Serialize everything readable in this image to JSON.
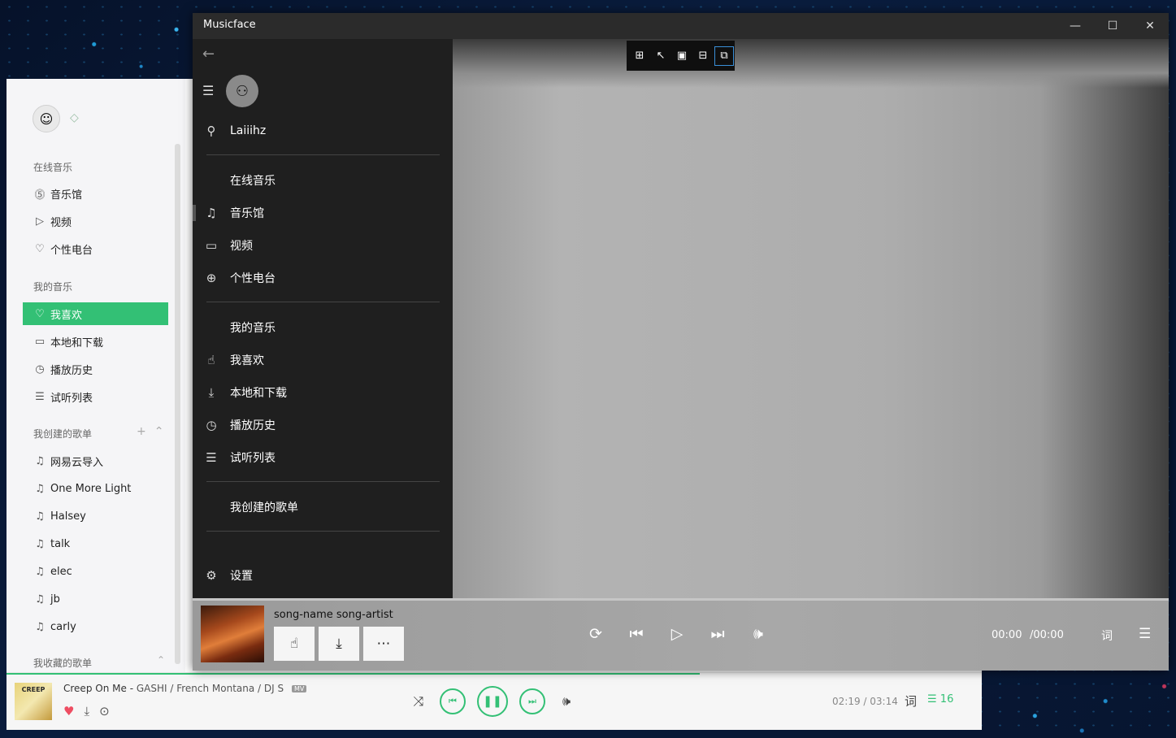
{
  "back_app": {
    "section_online": "在线音乐",
    "online_items": [
      {
        "icon": "music-hall-icon",
        "glyph": "⓹",
        "label": "音乐馆"
      },
      {
        "icon": "video-icon",
        "glyph": "▷",
        "label": "视频"
      },
      {
        "icon": "radio-heart-icon",
        "glyph": "♡",
        "label": "个性电台"
      }
    ],
    "section_my": "我的音乐",
    "my_items": [
      {
        "icon": "heart-icon",
        "glyph": "♡",
        "label": "我喜欢"
      },
      {
        "icon": "monitor-icon",
        "glyph": "▭",
        "label": "本地和下载"
      },
      {
        "icon": "clock-icon",
        "glyph": "◷",
        "label": "播放历史"
      },
      {
        "icon": "trial-list-icon",
        "glyph": "☰",
        "label": "试听列表"
      }
    ],
    "section_created": "我创建的歌单",
    "playlists": [
      "网易云导入",
      "One More Light",
      "Halsey",
      "talk",
      "elec",
      "jb",
      "carly"
    ],
    "section_collected": "我收藏的歌单",
    "now_playing": {
      "title": "Creep On Me",
      "artists": "GASHI / French Montana / DJ S",
      "badge": "MV",
      "time": "02:19 / 03:14",
      "lyrics_label": "词",
      "queue_count": "16",
      "cover_text": "CREEP"
    },
    "accent": "#33c075"
  },
  "musicface": {
    "window_title": "Musicface",
    "window_buttons": [
      "—",
      "☐",
      "✕"
    ],
    "username": "Laiiihz",
    "online_header": "在线音乐",
    "online_items": [
      {
        "icon": "music-note-icon",
        "glyph": "♫",
        "label": "音乐馆"
      },
      {
        "icon": "video-camera-icon",
        "glyph": "▭",
        "label": "视频"
      },
      {
        "icon": "globe-icon",
        "glyph": "⊕",
        "label": "个性电台"
      }
    ],
    "my_header": "我的音乐",
    "my_items": [
      {
        "icon": "thumbs-up-icon",
        "glyph": "☝",
        "label": "我喜欢"
      },
      {
        "icon": "download-icon",
        "glyph": "⤓",
        "label": "本地和下载"
      },
      {
        "icon": "clock-icon",
        "glyph": "◷",
        "label": "播放历史"
      },
      {
        "icon": "playlist-icon",
        "glyph": "☰",
        "label": "试听列表"
      }
    ],
    "created_header": "我创建的歌单",
    "settings_label": "设置",
    "toolbar_icons": [
      "select-element-icon",
      "pointer-icon",
      "frame-icon",
      "tree-icon",
      "inspect-icon"
    ],
    "player": {
      "song": "song-name song-artist",
      "time_current": "00:00",
      "time_total": "/00:00",
      "lyrics_label": "词"
    }
  }
}
